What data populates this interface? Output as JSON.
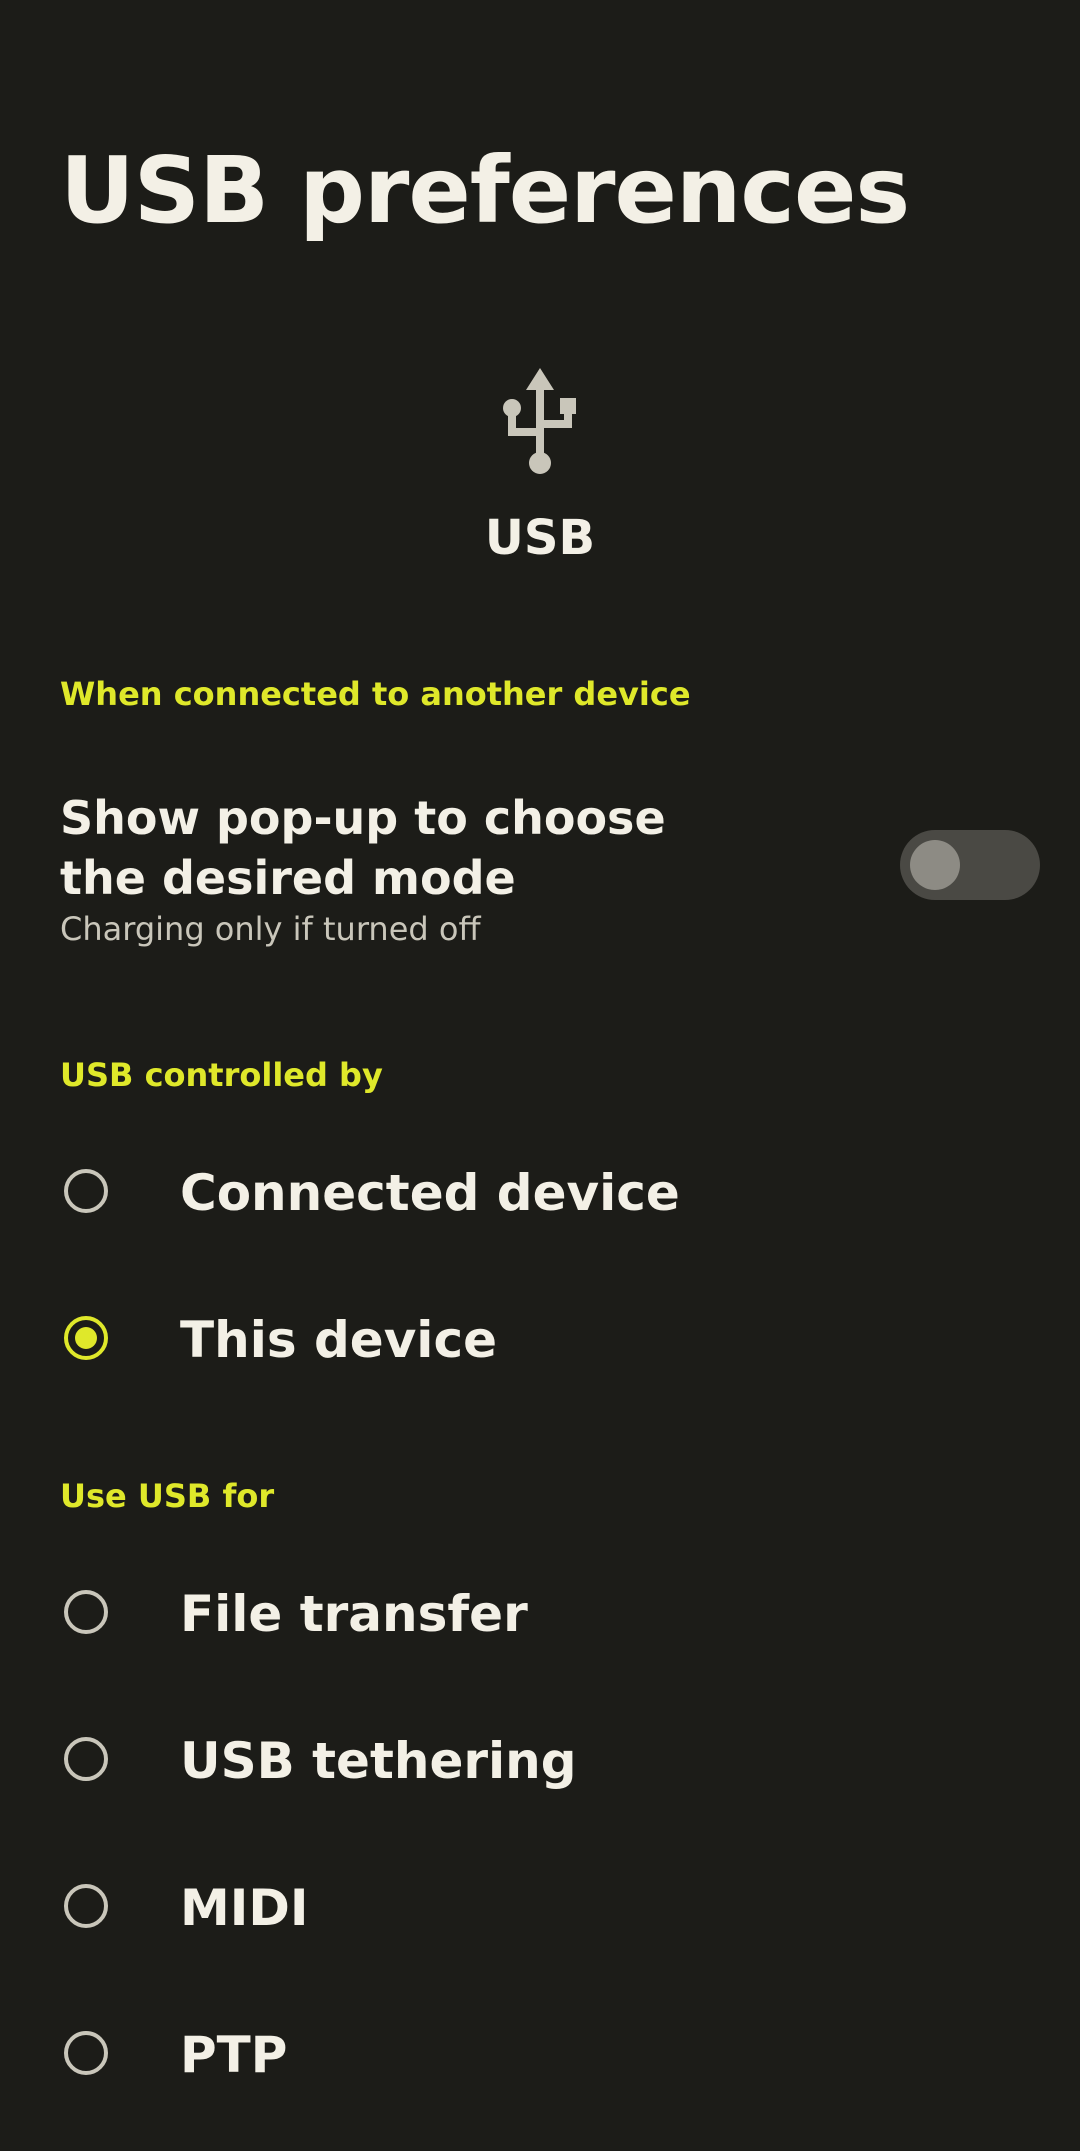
{
  "page_title": "USB preferences",
  "header": {
    "icon": "usb-icon",
    "label": "USB"
  },
  "colors": {
    "background": "#1c1c18",
    "accent": "#dfe82a",
    "text_primary": "#f3f0e6",
    "text_secondary": "#c9c6ba"
  },
  "section_connected": {
    "title": "When connected to another device",
    "popup_pref": {
      "title": "Show pop-up to choose the desired mode",
      "summary": "Charging only if turned off",
      "enabled": false
    }
  },
  "section_controlled": {
    "title": "USB controlled by",
    "options": [
      {
        "label": "Connected device",
        "selected": false
      },
      {
        "label": "This device",
        "selected": true
      }
    ]
  },
  "section_use_for": {
    "title": "Use USB for",
    "options": [
      {
        "label": "File transfer",
        "selected": false
      },
      {
        "label": "USB tethering",
        "selected": false
      },
      {
        "label": "MIDI",
        "selected": false
      },
      {
        "label": "PTP",
        "selected": false
      }
    ]
  }
}
